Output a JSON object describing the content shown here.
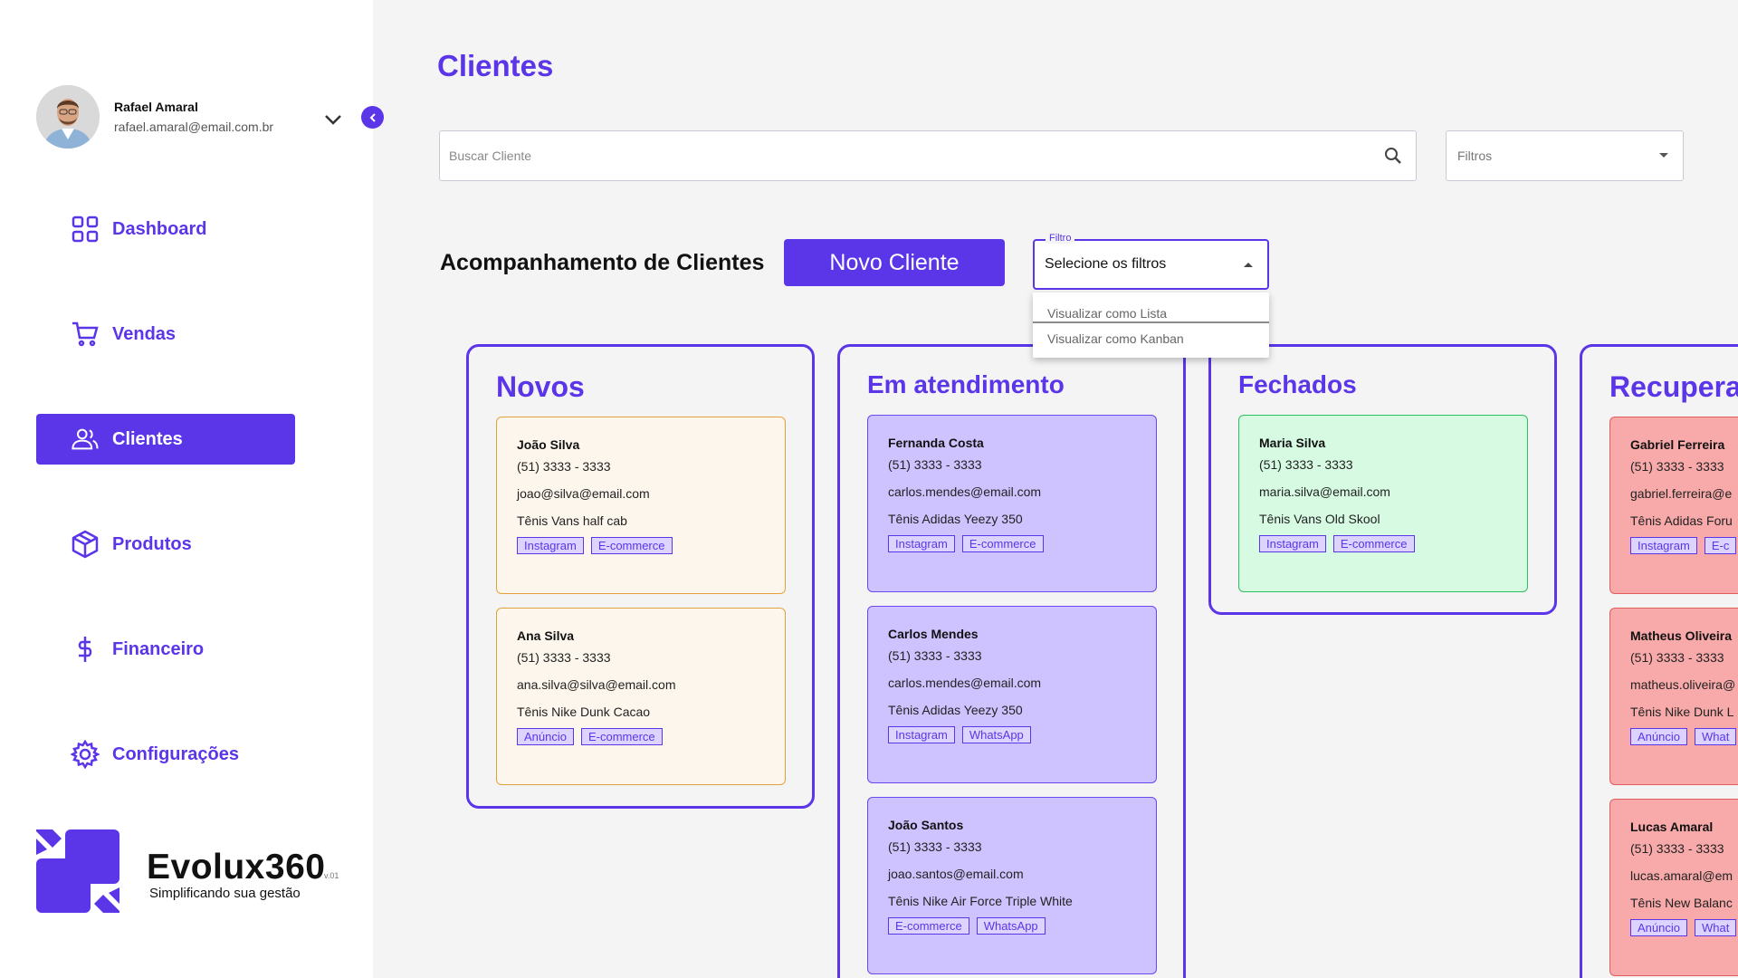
{
  "user": {
    "name": "Rafael Amaral",
    "email": "rafael.amaral@email.com.br"
  },
  "nav": [
    {
      "label": "Dashboard",
      "icon": "grid-icon",
      "active": false
    },
    {
      "label": "Vendas",
      "icon": "cart-icon",
      "active": false
    },
    {
      "label": "Clientes",
      "icon": "users-icon",
      "active": true
    },
    {
      "label": "Produtos",
      "icon": "box-icon",
      "active": false
    },
    {
      "label": "Financeiro",
      "icon": "dollar-icon",
      "active": false
    },
    {
      "label": "Configurações",
      "icon": "gear-icon",
      "active": false
    }
  ],
  "logo": {
    "title": "Evolux360",
    "version": "v.01",
    "subtitle": "Simplificando sua gestão"
  },
  "page": {
    "title": "Clientes",
    "search_placeholder": "Buscar Cliente",
    "filters_label": "Filtros",
    "section_title": "Acompanhamento de Clientes",
    "new_client_label": "Novo Cliente"
  },
  "filter_select": {
    "legend": "Filtro",
    "value": "Selecione os filtros",
    "options": [
      "Visualizar como Lista",
      "Visualizar como Kanban"
    ]
  },
  "colors": {
    "accent": "#5b35e8",
    "card_new": "#fdf6ec",
    "card_in_progress": "#cfc3ff",
    "card_closed": "#d6fbe2",
    "card_recovering": "#f8a9a9"
  },
  "columns": [
    {
      "title": "Novos",
      "cards": [
        {
          "name": "João Silva",
          "phone": "(51) 3333 - 3333",
          "email": "joao@silva@email.com",
          "product": "Tênis Vans half cab",
          "tags": [
            "Instagram",
            "E-commerce"
          ]
        },
        {
          "name": "Ana Silva",
          "phone": "(51) 3333 - 3333",
          "email": "ana.silva@silva@email.com",
          "product": "Tênis Nike Dunk Cacao",
          "tags": [
            "Anúncio",
            "E-commerce"
          ]
        }
      ]
    },
    {
      "title": "Em atendimento",
      "cards": [
        {
          "name": "Fernanda Costa",
          "phone": "(51) 3333 - 3333",
          "email": "carlos.mendes@email.com",
          "product": "Tênis Adidas Yeezy 350",
          "tags": [
            "Instagram",
            "E-commerce"
          ]
        },
        {
          "name": "Carlos Mendes",
          "phone": "(51) 3333 - 3333",
          "email": "carlos.mendes@email.com",
          "product": "Tênis Adidas Yeezy 350",
          "tags": [
            "Instagram",
            "WhatsApp"
          ]
        },
        {
          "name": "João Santos",
          "phone": "(51) 3333 - 3333",
          "email": "joao.santos@email.com",
          "product": "Tênis Nike Air Force Triple White",
          "tags": [
            "E-commerce",
            "WhatsApp"
          ]
        }
      ]
    },
    {
      "title": "Fechados",
      "cards": [
        {
          "name": "Maria Silva",
          "phone": "(51) 3333 - 3333",
          "email": "maria.silva@email.com",
          "product": "Tênis Vans Old Skool",
          "tags": [
            "Instagram",
            "E-commerce"
          ]
        }
      ]
    },
    {
      "title": "Recupera",
      "cards": [
        {
          "name": "Gabriel Ferreira",
          "phone": "(51) 3333 - 3333",
          "email": "gabriel.ferreira@e",
          "product": "Tênis Adidas Foru",
          "tags": [
            "Instagram",
            "E-c"
          ]
        },
        {
          "name": "Matheus Oliveira",
          "phone": "(51) 3333 - 3333",
          "email": "matheus.oliveira@",
          "product": "Tênis Nike Dunk L",
          "tags": [
            "Anúncio",
            "What"
          ]
        },
        {
          "name": "Lucas Amaral",
          "phone": "(51) 3333 - 3333",
          "email": "lucas.amaral@em",
          "product": "Tênis New Balanc",
          "tags": [
            "Anúncio",
            "What"
          ]
        }
      ]
    }
  ]
}
